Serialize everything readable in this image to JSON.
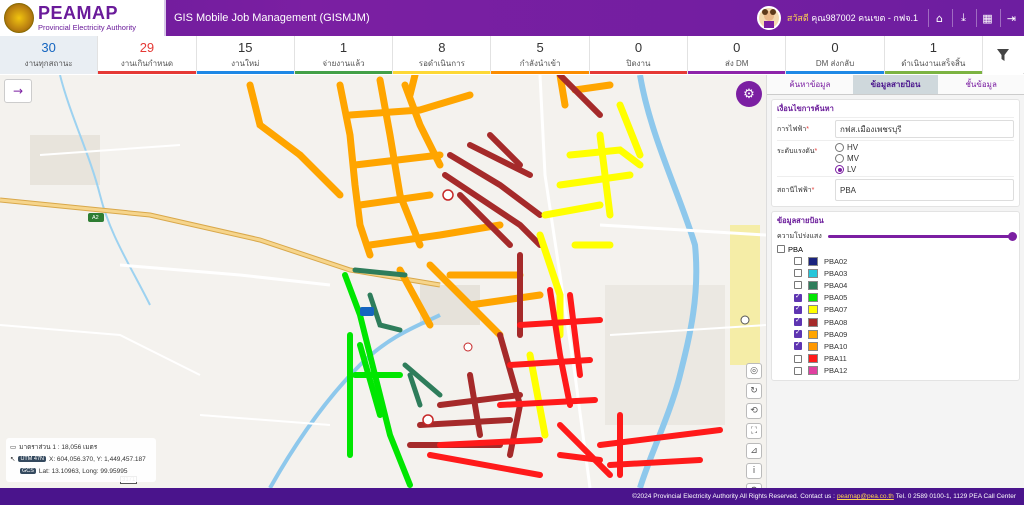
{
  "header": {
    "brand": "PEAMAP",
    "brand_sub": "Provincial Electricity Authority",
    "app_title": "GIS Mobile Job Management (GISMJM)",
    "user_first": "สวัสดี",
    "user_name": "คุณ987002 คนเขต - กฟจ.1",
    "icons": [
      "home-icon",
      "download-icon",
      "grid-icon",
      "logout-icon"
    ]
  },
  "stats": [
    {
      "num": "30",
      "label": "งานทุกสถานะ",
      "num_color": "#1565c0",
      "bar": "#e9eef3"
    },
    {
      "num": "29",
      "label": "งานเกินกำหนด",
      "num_color": "#e53935",
      "bar": "#e53935"
    },
    {
      "num": "15",
      "label": "งานใหม่",
      "num_color": "#333333",
      "bar": "#1e88e5"
    },
    {
      "num": "1",
      "label": "จ่ายงานแล้ว",
      "num_color": "#333333",
      "bar": "#43a047"
    },
    {
      "num": "8",
      "label": "รอดำเนินการ",
      "num_color": "#333333",
      "bar": "#fdd835"
    },
    {
      "num": "5",
      "label": "กำลังนำเข้า",
      "num_color": "#333333",
      "bar": "#fb8c00"
    },
    {
      "num": "0",
      "label": "ปิดงาน",
      "num_color": "#333333",
      "bar": "#e53935"
    },
    {
      "num": "0",
      "label": "ส่ง DM",
      "num_color": "#333333",
      "bar": "#8e24aa"
    },
    {
      "num": "0",
      "label": "DM ส่งกลับ",
      "num_color": "#333333",
      "bar": "#1e88e5"
    },
    {
      "num": "1",
      "label": "ดำเนินงานเสร็จสิ้น",
      "num_color": "#333333",
      "bar": "#7cb342"
    }
  ],
  "panel": {
    "tabs": [
      "ค้นหาข้อมูล",
      "ข้อมูลสายป้อน",
      "ชั้นข้อมูล"
    ],
    "active_tab": 1,
    "search_title": "เงื่อนไขการค้นหา",
    "office_label": "การไฟฟ้า",
    "office_value": "กฟส.เมืองเพชรบุรี",
    "voltage_label": "ระดับแรงดัน",
    "voltage_options": [
      "HV",
      "MV",
      "LV"
    ],
    "voltage_selected": "LV",
    "station_label": "สถานีไฟฟ้า",
    "station_value": "PBA",
    "feeder_title": "ข้อมูลสายป้อน",
    "opacity_label": "ความโปร่งแสง",
    "opacity": 1.0,
    "group_name": "PBA",
    "layers": [
      {
        "name": "PBA02",
        "color": "#1a237e",
        "checked": false
      },
      {
        "name": "PBA03",
        "color": "#26c6da",
        "checked": false
      },
      {
        "name": "PBA04",
        "color": "#2e7d5b",
        "checked": false
      },
      {
        "name": "PBA05",
        "color": "#00e600",
        "checked": true
      },
      {
        "name": "PBA07",
        "color": "#ffff00",
        "checked": true
      },
      {
        "name": "PBA08",
        "color": "#a52a2a",
        "checked": true
      },
      {
        "name": "PBA09",
        "color": "#ffa500",
        "checked": true
      },
      {
        "name": "PBA10",
        "color": "#ff9800",
        "checked": true
      },
      {
        "name": "PBA11",
        "color": "#ff1a1a",
        "checked": false
      },
      {
        "name": "PBA12",
        "color": "#e040a0",
        "checked": false
      }
    ]
  },
  "map": {
    "scale_text": "มาตราส่วน 1 : 18,056 เมตร",
    "utm_tag": "UTM 47N",
    "utm_text": "X: 604,056.370, Y: 1,449,457.187",
    "gcs_tag": "GCS",
    "gcs_text": "Lat: 13.10963, Long: 99.95995",
    "road_label": "A2",
    "road_number": "3171"
  },
  "footer": {
    "pre": "©2024 Provincial Electricity Authority All Rights Reserved. Contact us :",
    "email": "peamap@pea.co.th",
    "post": "Tel. 0 2589 0100-1, 1129 PEA Call Center"
  }
}
